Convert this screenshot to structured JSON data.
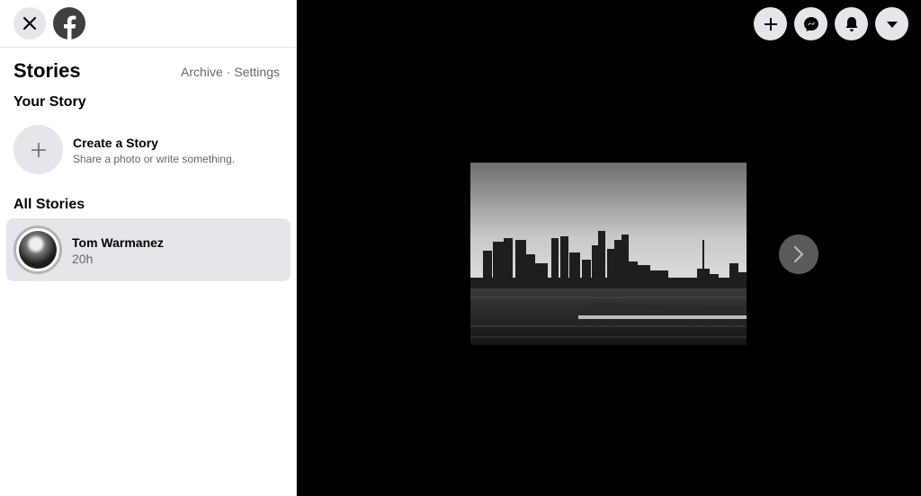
{
  "header": {
    "close_icon": "close-icon",
    "logo_icon": "facebook-logo-icon"
  },
  "stories": {
    "title": "Stories",
    "archive_label": "Archive",
    "separator": "·",
    "settings_label": "Settings"
  },
  "your_story": {
    "label": "Your Story",
    "create_title": "Create a Story",
    "create_subtitle": "Share a photo or write something."
  },
  "all_stories": {
    "label": "All Stories",
    "items": [
      {
        "name": "Tom Warmanez",
        "time": "20h"
      }
    ]
  },
  "toolbar": {
    "icons": [
      "plus-icon",
      "messenger-icon",
      "notifications-bell-icon",
      "dropdown-caret-icon"
    ]
  },
  "viewer": {
    "next_icon": "chevron-right-icon"
  },
  "colors": {
    "panel_bg": "#ffffff",
    "viewer_bg": "#000000",
    "button_bg": "#e4e6eb",
    "muted_text": "#65676b",
    "selected_bg": "#e4e6eb"
  }
}
